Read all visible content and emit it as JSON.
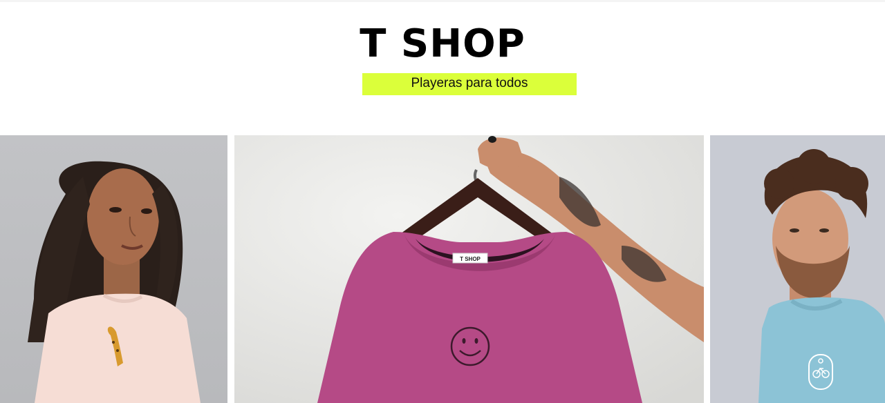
{
  "header": {
    "brand": "T SHOP",
    "tagline": "Playeras para todos"
  },
  "gallery": {
    "label_tag": "T SHOP"
  },
  "colors": {
    "tagline_bg": "#dbff3a",
    "shirt_pink": "#b54a86",
    "shirt_blue": "#8cc3d6",
    "shirt_cream": "#f6ddd5"
  }
}
